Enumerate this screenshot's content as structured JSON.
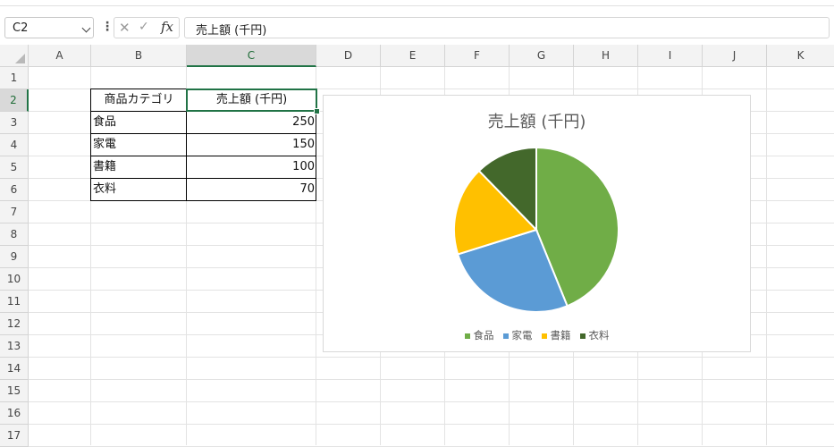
{
  "formula_bar": {
    "name_box": "C2",
    "formula": "売上額 (千円)"
  },
  "columns": [
    "A",
    "B",
    "C",
    "D",
    "E",
    "F",
    "G",
    "H",
    "I",
    "J",
    "K"
  ],
  "rows": [
    "1",
    "2",
    "3",
    "4",
    "5",
    "6",
    "7",
    "8",
    "9",
    "10",
    "11",
    "12",
    "13",
    "14",
    "15",
    "16",
    "17"
  ],
  "table": {
    "header": {
      "category": "商品カテゴリ",
      "sales": "売上額 (千円)"
    },
    "rows": [
      {
        "category": "食品",
        "sales": "250"
      },
      {
        "category": "家電",
        "sales": "150"
      },
      {
        "category": "書籍",
        "sales": "100"
      },
      {
        "category": "衣料",
        "sales": "70"
      }
    ]
  },
  "chart_data": {
    "type": "pie",
    "title": "売上額 (千円)",
    "categories": [
      "食品",
      "家電",
      "書籍",
      "衣料"
    ],
    "values": [
      250,
      150,
      100,
      70
    ],
    "colors": [
      "#70AD47",
      "#5B9BD5",
      "#FFC000",
      "#43682B"
    ],
    "legend_position": "bottom"
  }
}
